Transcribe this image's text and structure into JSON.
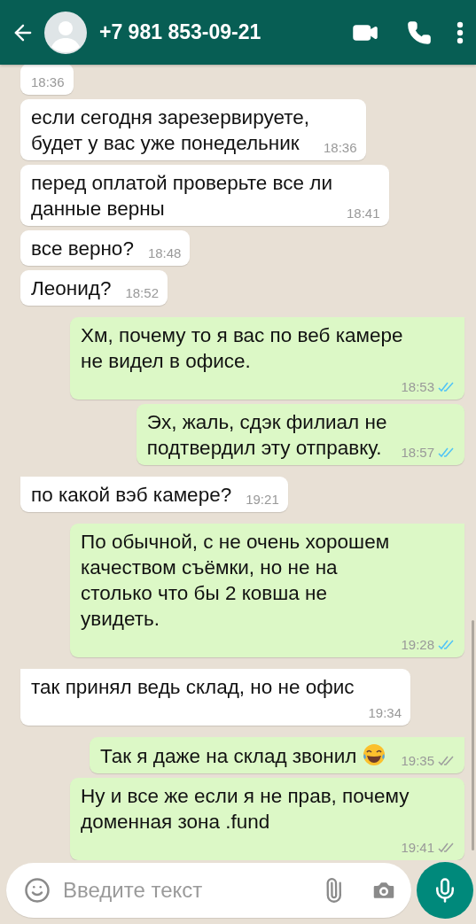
{
  "header": {
    "title": "+7 981 853-09-21"
  },
  "messages": [
    {
      "outgoing": false,
      "tail": false,
      "time": "18:36"
    },
    {
      "outgoing": false,
      "tail": false,
      "text": "если сегодня зарезервируете,\nбудет у вас уже понедельник",
      "time": "18:36"
    },
    {
      "outgoing": false,
      "tail": false,
      "text": "перед оплатой проверьте все ли\nданные верны",
      "time": "18:41"
    },
    {
      "outgoing": false,
      "tail": false,
      "text": "все верно?",
      "time": "18:48"
    },
    {
      "outgoing": false,
      "tail": false,
      "text": "Леонид?",
      "time": "18:52"
    },
    {
      "outgoing": true,
      "tail": true,
      "text": "Хм, почему то я вас по веб камере\nне видел в офисе.",
      "time": "18:53",
      "read": true
    },
    {
      "outgoing": true,
      "tail": false,
      "text": "Эх, жаль, сдэк филиал не\nподтвердил эту отправку.",
      "time": "18:57",
      "read": true
    },
    {
      "outgoing": false,
      "tail": true,
      "text": "по какой вэб камере?",
      "time": "19:21"
    },
    {
      "outgoing": true,
      "tail": true,
      "text": "По обычной, с не очень хорошем\nкачеством съёмки, но не на\nстолько что бы 2 ковша не\nувидеть.",
      "time": "19:28",
      "read": true
    },
    {
      "outgoing": false,
      "tail": true,
      "text": "так принял ведь склад, но не офис",
      "time": "19:34"
    },
    {
      "outgoing": true,
      "tail": true,
      "text": "Так я даже на склад звонил",
      "emoji": true,
      "time": "19:35",
      "read": false
    },
    {
      "outgoing": true,
      "tail": false,
      "text": "Ну и все же если я не прав, почему\nдоменная зона .fund",
      "time": "19:41",
      "read": false
    }
  ],
  "composer": {
    "placeholder": "Введите текст"
  }
}
